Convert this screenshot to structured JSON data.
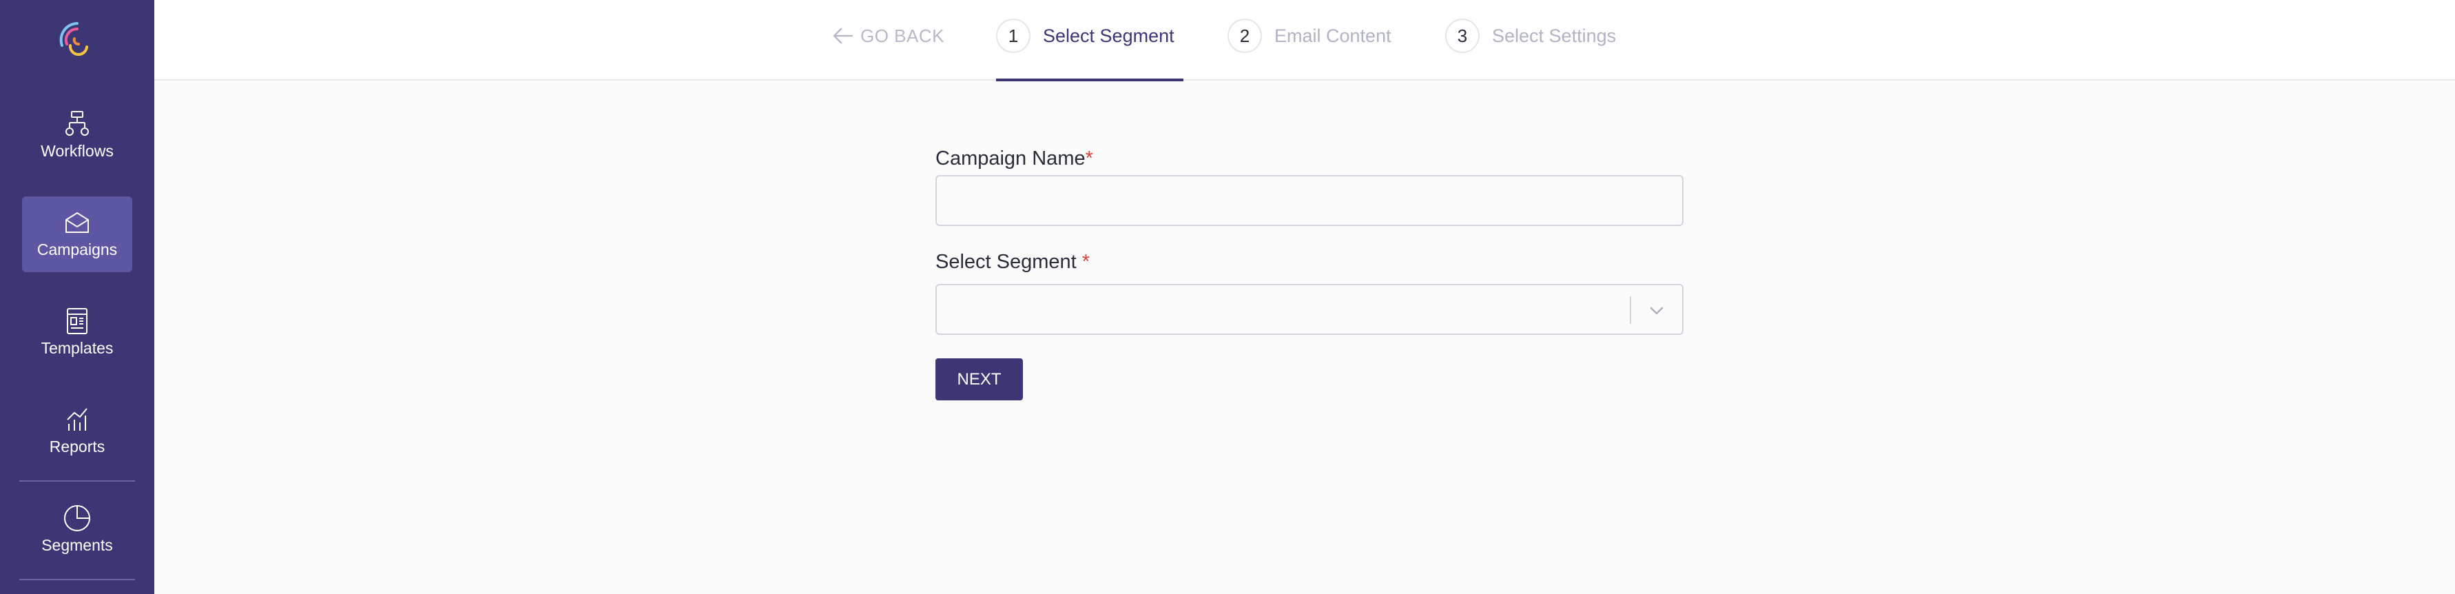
{
  "brand": {
    "primary": "#3c3675",
    "active_item": "#5d56a3",
    "required": "#d9413b"
  },
  "sidebar": {
    "logo_icon": "rainbow-arc-logo",
    "items": [
      {
        "label": "Workflows",
        "icon": "workflow-icon",
        "active": false
      },
      {
        "label": "Campaigns",
        "icon": "envelope-icon",
        "active": true
      },
      {
        "label": "Templates",
        "icon": "template-icon",
        "active": false
      },
      {
        "label": "Reports",
        "icon": "chart-icon",
        "active": false
      },
      {
        "label": "Segments",
        "icon": "pie-icon",
        "active": false
      }
    ]
  },
  "wizard": {
    "back_label": "GO BACK",
    "steps": [
      {
        "number": "1",
        "label": "Select Segment",
        "active": true
      },
      {
        "number": "2",
        "label": "Email Content",
        "active": false
      },
      {
        "number": "3",
        "label": "Select Settings",
        "active": false
      }
    ]
  },
  "form": {
    "campaign_name_label": "Campaign Name",
    "campaign_name_value": "",
    "segment_label": "Select Segment",
    "segment_value": "",
    "required_mark": "*",
    "next_label": "NEXT"
  }
}
